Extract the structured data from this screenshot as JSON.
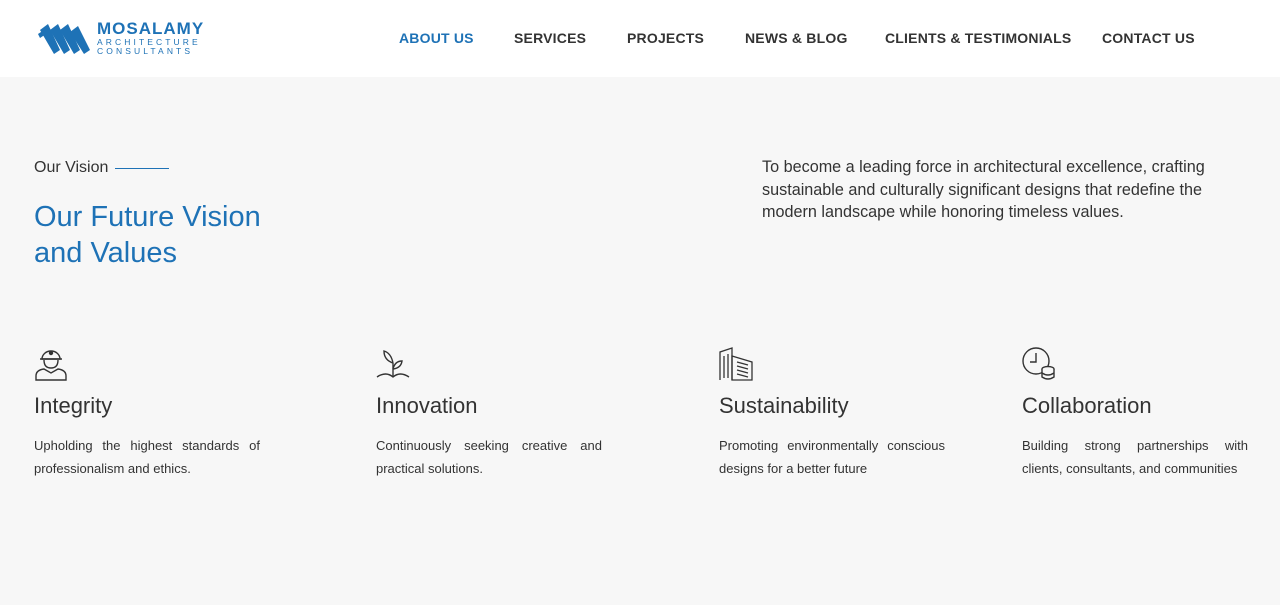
{
  "brand": {
    "name": "MOSALAMY",
    "tagline_line1": "ARCHITECTURE",
    "tagline_line2": "CONSULTANTS",
    "color": "#1e72b6"
  },
  "nav": {
    "items": [
      {
        "label": "ABOUT US",
        "active": true
      },
      {
        "label": "SERVICES",
        "active": false
      },
      {
        "label": "PROJECTS",
        "active": false
      },
      {
        "label": "NEWS & BLOG",
        "active": false
      },
      {
        "label": "CLIENTS & TESTIMONIALS",
        "active": false
      },
      {
        "label": "CONTACT US",
        "active": false
      }
    ]
  },
  "vision": {
    "eyebrow": "Our Vision",
    "title_line1": "Our Future Vision",
    "title_line2": "and Values",
    "lead": "To become a leading force in architectural excellence, crafting sustainable and culturally significant designs that redefine the modern landscape while honoring timeless values."
  },
  "values": [
    {
      "icon": "worker-helmet-icon",
      "title": "Integrity",
      "description": "Upholding the highest standards of professionalism and ethics."
    },
    {
      "icon": "sprout-icon",
      "title": "Innovation",
      "description": "Continuously seeking creative and practical solutions."
    },
    {
      "icon": "buildings-icon",
      "title": "Sustainability",
      "description": "Promoting environmentally conscious designs for a better future"
    },
    {
      "icon": "clock-coins-icon",
      "title": "Collaboration",
      "description": "Building strong partnerships with clients, consultants, and communities"
    }
  ]
}
